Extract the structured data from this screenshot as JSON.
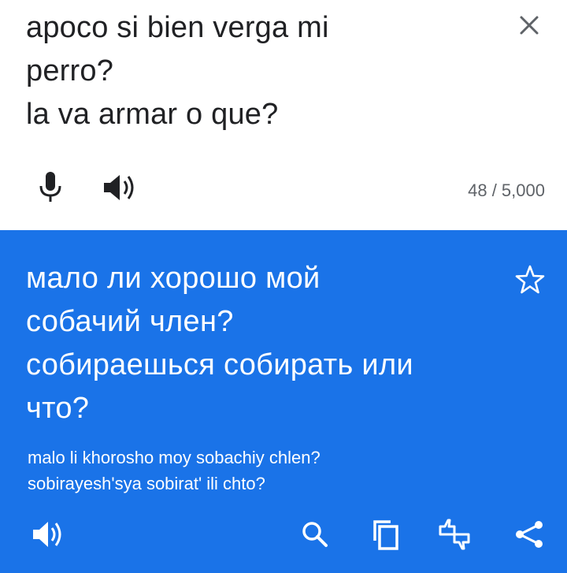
{
  "source": {
    "lines": [
      "apoco si bien verga mi",
      "perro?",
      "la va armar o que?"
    ],
    "char_count": "48 / 5,000"
  },
  "result": {
    "lines": [
      "мало ли хорошо мой",
      "собачий член?",
      "собираешься собирать или",
      "что?"
    ],
    "transliteration": [
      "malo li khorosho moy sobachiy chlen?",
      "sobirayesh'sya sobirat' ili chto?"
    ]
  },
  "icons": {
    "close": "close-icon",
    "mic": "microphone-icon",
    "source_speaker": "speaker-icon",
    "star": "star-icon",
    "result_speaker": "speaker-icon",
    "search": "search-icon",
    "copy": "copy-icon",
    "feedback": "feedback-icon",
    "share": "share-icon"
  },
  "colors": {
    "result_background": "#1a73e8",
    "source_text": "#202124",
    "muted_text": "#5f6368"
  }
}
